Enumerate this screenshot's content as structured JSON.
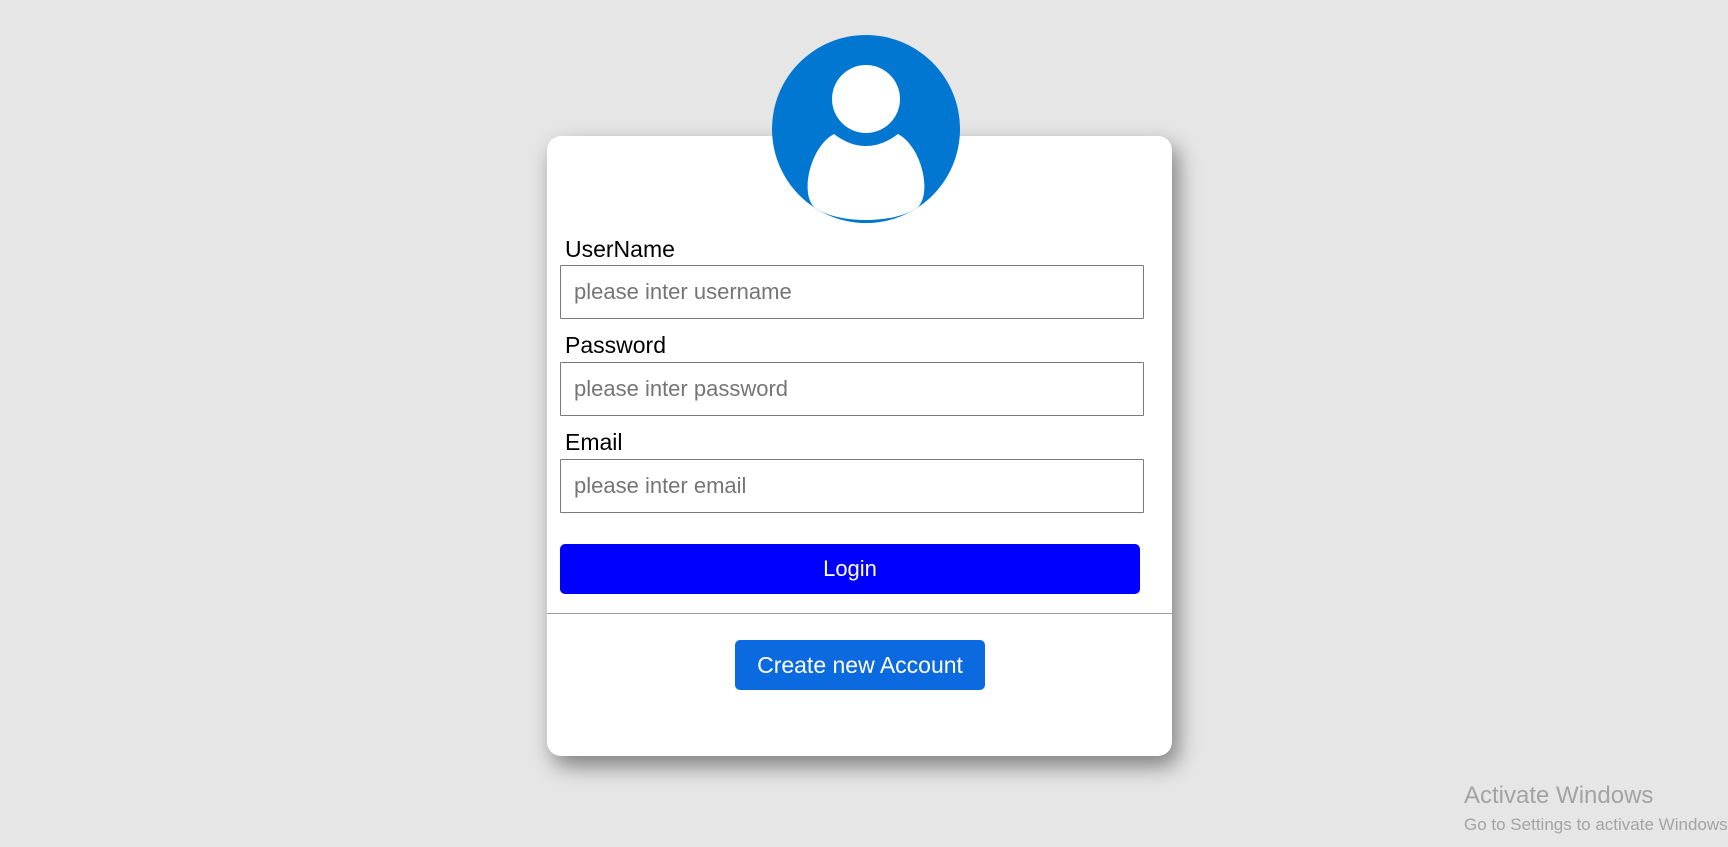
{
  "form": {
    "username": {
      "label": "UserName",
      "placeholder": "please inter username",
      "value": ""
    },
    "password": {
      "label": "Password",
      "placeholder": "please inter password",
      "value": ""
    },
    "email": {
      "label": "Email",
      "placeholder": "please inter email",
      "value": ""
    },
    "login_label": "Login",
    "create_account_label": "Create new Account"
  },
  "avatar": {
    "icon": "user-icon",
    "color": "#0277d1"
  },
  "colors": {
    "background": "#e6e6e6",
    "card": "#ffffff",
    "login_button": "#0000ff",
    "create_button": "#0b6ae0"
  },
  "watermark": {
    "title": "Activate Windows",
    "subtitle": "Go to Settings to activate Windows."
  }
}
